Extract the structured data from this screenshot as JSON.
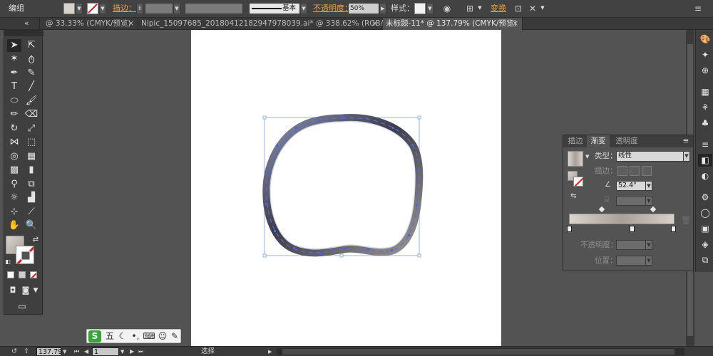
{
  "control_bar": {
    "selection_label": "编组",
    "stroke_label": "描边：",
    "stroke_style_label": "基本",
    "opacity_label": "不透明度：",
    "opacity_value": "50%",
    "style_label": "样式：",
    "transform_label": "变换",
    "colors": {
      "orange": "#e7a13a"
    }
  },
  "tabs": [
    {
      "label": "@ 33.33% (CMYK/预览)",
      "active": false
    },
    {
      "label": "Nipic_15097685_20180412182947978039.ai* @ 338.62% (RGB/预览)",
      "active": false
    },
    {
      "label": "未标题-11* @ 137.79% (CMYK/预览)",
      "active": true
    }
  ],
  "tabs_overflow": "«",
  "gradient_panel": {
    "tabs": [
      "描边",
      "渐变",
      "透明度"
    ],
    "active_tab": 1,
    "type_label": "类型：",
    "type_value": "线性",
    "stroke_label": "描边：",
    "angle_value": "52.4°",
    "opacity_label": "不透明度：",
    "position_label": "位置：",
    "gradient_colors": [
      "#d9d5cf",
      "#a99f98",
      "#d7d1c9"
    ]
  },
  "status_bar": {
    "zoom": "137.79",
    "page": "1",
    "tool_name": "选择"
  },
  "ime_bar": {
    "logo": "S",
    "mode": "五"
  }
}
